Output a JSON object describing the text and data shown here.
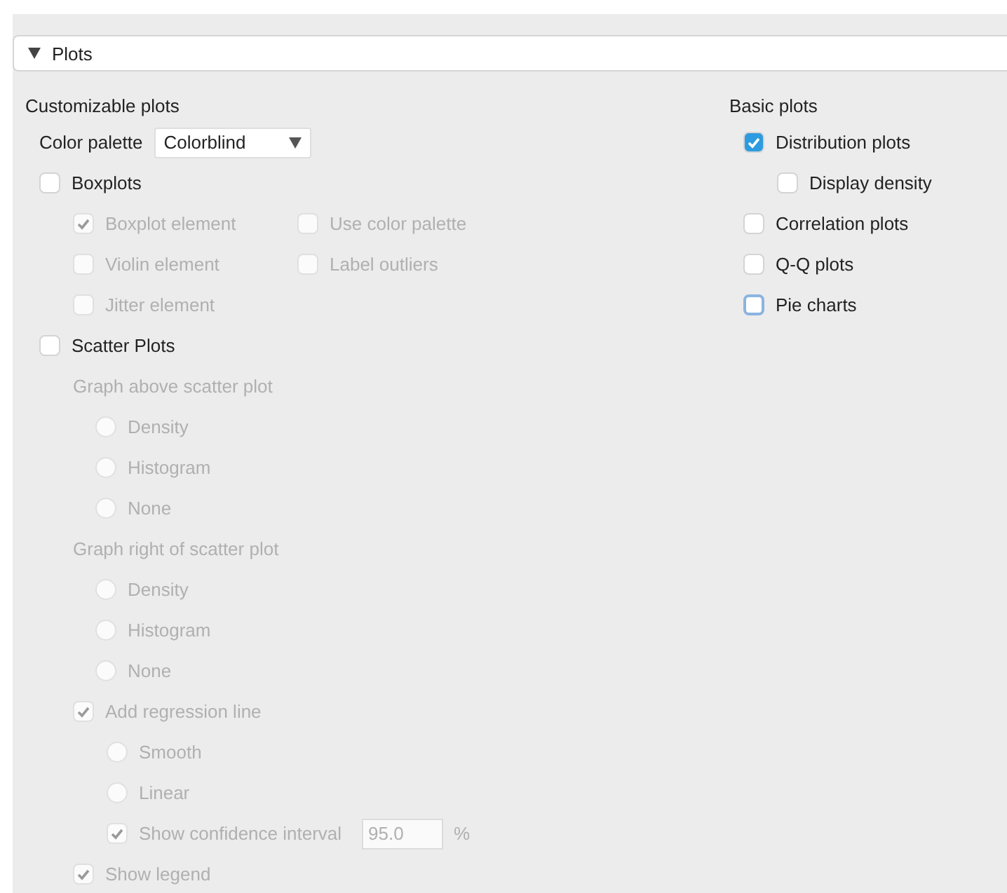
{
  "section": {
    "title": "Plots",
    "expanded": true
  },
  "columns": [
    {
      "heading": "Customizable plots",
      "items": [
        {
          "kind": "dropdown",
          "label": "Color palette",
          "value": "Colorblind",
          "disabled": false
        },
        {
          "kind": "checkbox",
          "label": "Boxplots",
          "checked": false,
          "disabled": false,
          "focused": false,
          "child_columns": [
            [
              {
                "kind": "checkbox",
                "label": "Boxplot element",
                "checked": true,
                "disabled": true,
                "focused": false
              },
              {
                "kind": "checkbox",
                "label": "Violin element",
                "checked": false,
                "disabled": true,
                "focused": false
              },
              {
                "kind": "checkbox",
                "label": "Jitter element",
                "checked": false,
                "disabled": true,
                "focused": false
              }
            ],
            [
              {
                "kind": "checkbox",
                "label": "Use color palette",
                "checked": false,
                "disabled": true,
                "focused": false
              },
              {
                "kind": "checkbox",
                "label": "Label outliers",
                "checked": false,
                "disabled": true,
                "focused": false
              }
            ]
          ]
        },
        {
          "kind": "checkbox",
          "label": "Scatter Plots",
          "checked": false,
          "disabled": false,
          "focused": false,
          "children": [
            {
              "kind": "label",
              "label": "Graph above scatter plot",
              "disabled": true,
              "children": [
                {
                  "kind": "radio",
                  "label": "Density",
                  "selected": false,
                  "disabled": true
                },
                {
                  "kind": "radio",
                  "label": "Histogram",
                  "selected": false,
                  "disabled": true
                },
                {
                  "kind": "radio",
                  "label": "None",
                  "selected": false,
                  "disabled": true
                }
              ]
            },
            {
              "kind": "label",
              "label": "Graph right of scatter plot",
              "disabled": true,
              "children": [
                {
                  "kind": "radio",
                  "label": "Density",
                  "selected": false,
                  "disabled": true
                },
                {
                  "kind": "radio",
                  "label": "Histogram",
                  "selected": false,
                  "disabled": true
                },
                {
                  "kind": "radio",
                  "label": "None",
                  "selected": false,
                  "disabled": true
                }
              ]
            },
            {
              "kind": "checkbox",
              "label": "Add regression line",
              "checked": true,
              "disabled": true,
              "focused": false,
              "children": [
                {
                  "kind": "radio",
                  "label": "Smooth",
                  "selected": false,
                  "disabled": true
                },
                {
                  "kind": "radio",
                  "label": "Linear",
                  "selected": false,
                  "disabled": true
                },
                {
                  "kind": "checkbox",
                  "label": "Show confidence interval",
                  "checked": true,
                  "disabled": true,
                  "focused": false,
                  "field": "95.0",
                  "suffix": "%"
                }
              ]
            },
            {
              "kind": "checkbox",
              "label": "Show legend",
              "checked": true,
              "disabled": true,
              "focused": false
            }
          ]
        }
      ]
    },
    {
      "heading": "Basic plots",
      "items": [
        {
          "kind": "checkbox",
          "label": "Distribution plots",
          "checked": true,
          "disabled": false,
          "focused": false,
          "children": [
            {
              "kind": "checkbox",
              "label": "Display density",
              "checked": false,
              "disabled": false,
              "focused": false
            }
          ]
        },
        {
          "kind": "checkbox",
          "label": "Correlation plots",
          "checked": false,
          "disabled": false,
          "focused": false
        },
        {
          "kind": "checkbox",
          "label": "Q-Q plots",
          "checked": false,
          "disabled": false,
          "focused": false
        },
        {
          "kind": "checkbox",
          "label": "Pie charts",
          "checked": false,
          "disabled": false,
          "focused": true
        }
      ]
    }
  ]
}
